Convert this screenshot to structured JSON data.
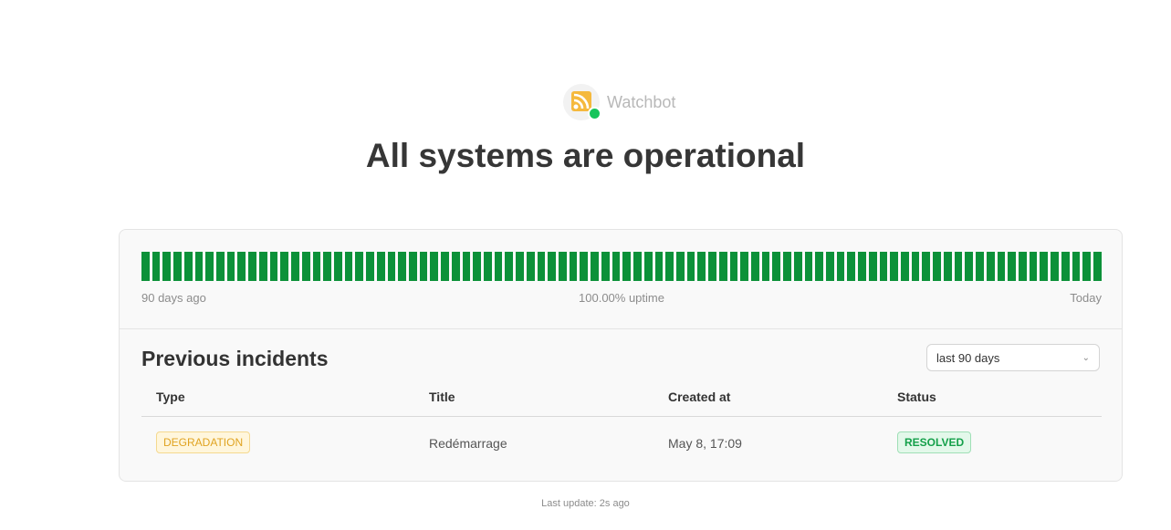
{
  "brand": {
    "name": "Watchbot",
    "logo_icon": "rss-feed-icon",
    "status_indicator": "online-status-dot",
    "accent_color": "#f5b93d",
    "status_color": "#16c45b"
  },
  "headline": "All systems are operational",
  "uptime": {
    "day_count": 90,
    "bar_color": "#0c9139",
    "start_label": "90 days ago",
    "summary_label": "100.00% uptime",
    "end_label": "Today"
  },
  "incidents": {
    "title": "Previous incidents",
    "period_select": {
      "value": "last 90 days",
      "icon": "chevron-down-icon"
    },
    "columns": [
      "Type",
      "Title",
      "Created at",
      "Status"
    ],
    "rows": [
      {
        "type": "DEGRADATION",
        "title": "Redémarrage",
        "created_at": "May 8, 17:09",
        "status": "RESOLVED"
      }
    ]
  },
  "footer": {
    "last_update": "Last update: 2s ago"
  }
}
